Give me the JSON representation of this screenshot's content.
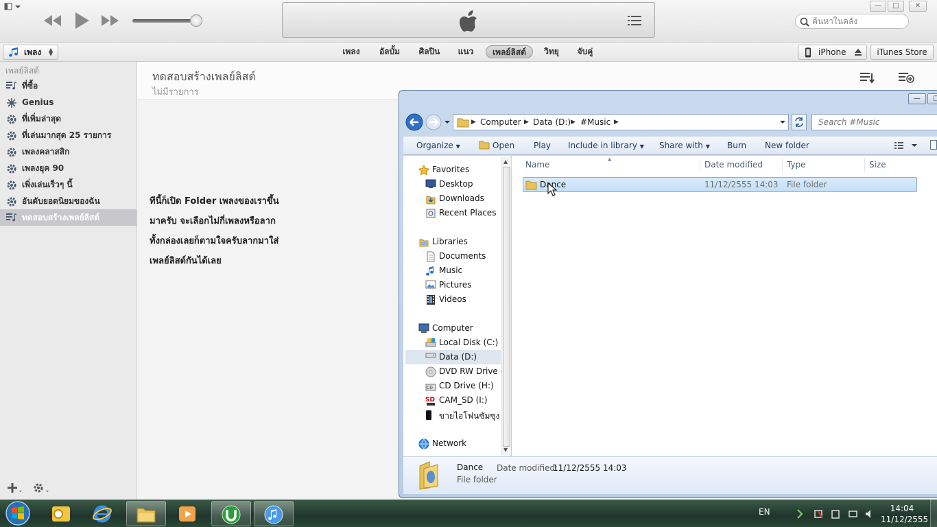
{
  "itunes": {
    "search_placeholder": "ค้นหาในคลัง",
    "media_selector": "เพลง",
    "nav_tabs": [
      "เพลง",
      "อัลบั้ม",
      "ศิลปิน",
      "แนว",
      "เพลย์ลิสต์",
      "วิทยุ",
      "จับคู่"
    ],
    "selected_tab_index": 4,
    "device_label": "iPhone",
    "store_label": "iTunes Store",
    "sidebar": {
      "heading": "เพลย์ลิสต์",
      "items": [
        {
          "label": "ที่ซื้อ",
          "icon": "playlist-icon"
        },
        {
          "label": "Genius",
          "icon": "genius-icon"
        },
        {
          "label": "ที่เพิ่มล่าสุด",
          "icon": "smart-playlist-gear-icon"
        },
        {
          "label": "ที่เล่นมากสุด 25 รายการ",
          "icon": "smart-playlist-gear-icon"
        },
        {
          "label": "เพลงคลาสสิก",
          "icon": "smart-playlist-gear-icon"
        },
        {
          "label": "เพลงยุค 90",
          "icon": "smart-playlist-gear-icon"
        },
        {
          "label": "เพิ่งเล่นเร็วๆ นี้",
          "icon": "smart-playlist-gear-icon"
        },
        {
          "label": "อันดับยอดนิยมของฉัน",
          "icon": "smart-playlist-gear-icon"
        },
        {
          "label": "ทดสอบสร้างเพลย์ลิสต์",
          "icon": "playlist-icon"
        }
      ],
      "selected_index": 8
    },
    "playlist": {
      "title": "ทดสอบสร้างเพลย์ลิสต์",
      "subtitle": "ไม่มีรายการ"
    },
    "note_text": "ทีนี้ก็เปิด   Folder เพลงของเราขึ้น\nมาครับ   จะเลือกไม่กี่เพลงหรือลาก\nทั้งกล่องเลยก็ตามใจครับลากมาใส่\nเพลย์ลิสต์กันได้เลย"
  },
  "explorer": {
    "breadcrumb": [
      "Computer",
      "Data (D:)",
      "#Music"
    ],
    "search_placeholder": "Search #Music",
    "toolbar": {
      "organize": "Organize",
      "open": "Open",
      "play": "Play",
      "include": "Include in library",
      "share": "Share with",
      "burn": "Burn",
      "new_folder": "New folder"
    },
    "nav": {
      "favorites": "Favorites",
      "desktop": "Desktop",
      "downloads": "Downloads",
      "recent": "Recent Places",
      "libraries": "Libraries",
      "documents": "Documents",
      "music": "Music",
      "pictures": "Pictures",
      "videos": "Videos",
      "computer": "Computer",
      "local_c": "Local Disk (C:)",
      "data_d": "Data (D:)",
      "dvd_e": "DVD RW Drive (E:",
      "cd_h": "CD Drive (H:)",
      "cam_i": "CAM_SD (I:)",
      "phone": "ขายไอโฟนซัมซุง ติ",
      "network": "Network"
    },
    "columns": {
      "name": "Name",
      "date": "Date modified",
      "type": "Type",
      "size": "Size"
    },
    "files": [
      {
        "name": "Dance",
        "date": "11/12/2555 14:03",
        "type": "File folder",
        "size": ""
      }
    ],
    "details": {
      "name": "Dance",
      "date_label": "Date modified:",
      "date_value": "11/12/2555 14:03",
      "type": "File folder"
    }
  },
  "taskbar": {
    "language": "EN",
    "time": "14:04",
    "date": "11/12/2555"
  }
}
